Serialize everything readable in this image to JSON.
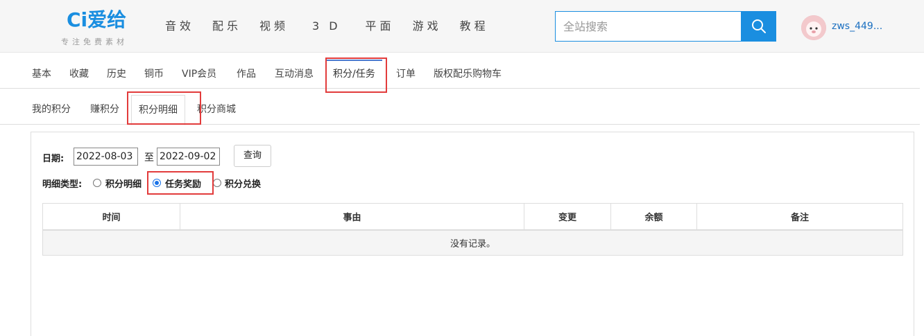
{
  "header": {
    "logo_text": "Ci爱给",
    "logo_sub": "专注免费素材",
    "nav": [
      "音效",
      "配乐",
      "视频",
      "3D",
      "平面",
      "游戏",
      "教程"
    ],
    "search_placeholder": "全站搜索",
    "username": "zws_449..."
  },
  "account_tabs": [
    "基本",
    "收藏",
    "历史",
    "铜币",
    "VIP会员",
    "作品",
    "互动消息",
    "积分/任务",
    "订单",
    "版权配乐购物车"
  ],
  "active_account_tab": "积分/任务",
  "points_tabs": [
    "我的积分",
    "赚积分",
    "积分明细",
    "积分商城"
  ],
  "active_points_tab": "积分明细",
  "filter": {
    "date_label": "日期:",
    "start_date": "2022-08-03",
    "to_text": "至",
    "end_date": "2022-09-02",
    "query_button": "查询",
    "type_label": "明细类型:",
    "types": [
      "积分明细",
      "任务奖励",
      "积分兑换"
    ],
    "selected_type": "任务奖励"
  },
  "table": {
    "columns": [
      "时间",
      "事由",
      "变更",
      "余额",
      "备注"
    ],
    "empty_text": "没有记录。"
  },
  "colors": {
    "brand": "#1a8ee0",
    "highlight": "#e23b3b"
  }
}
